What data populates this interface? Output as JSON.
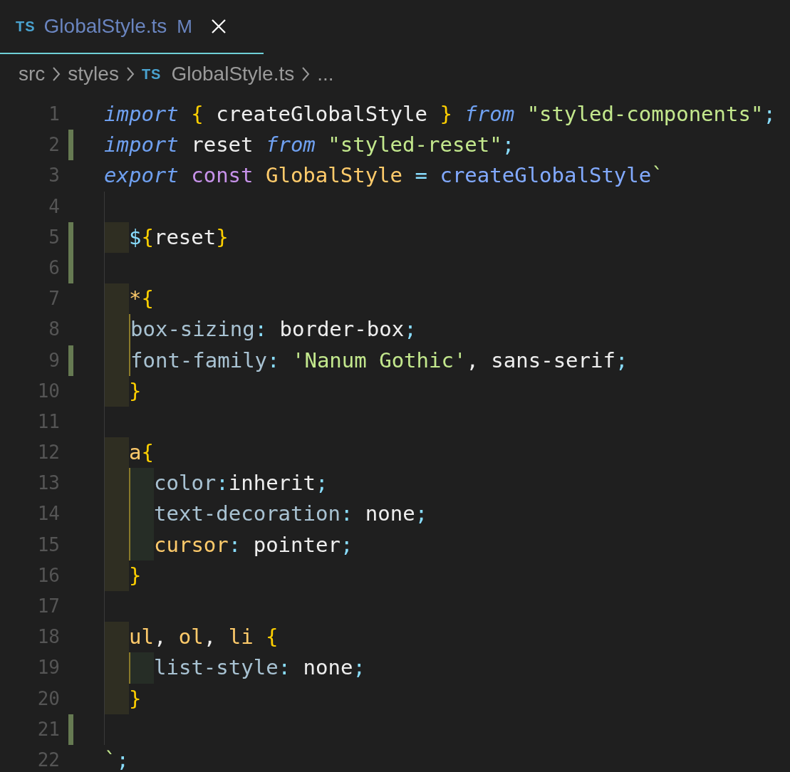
{
  "tab": {
    "icon_label": "TS",
    "title": "GlobalStyle.ts",
    "status": "M",
    "selected": true
  },
  "breadcrumbs": [
    {
      "label": "src"
    },
    {
      "label": "styles"
    },
    {
      "icon_label": "TS",
      "label": "GlobalStyle.ts"
    },
    {
      "label": "..."
    }
  ],
  "lines": [
    {
      "number": "1",
      "modified": false,
      "tokens": [
        {
          "kind": "keyword",
          "text": "import "
        },
        {
          "kind": "bracket",
          "text": "{"
        },
        {
          "kind": "plain",
          "text": " createGlobalStyle "
        },
        {
          "kind": "bracket",
          "text": "} "
        },
        {
          "kind": "keyword",
          "text": "from "
        },
        {
          "kind": "string",
          "text": "\"styled-components\""
        },
        {
          "kind": "punctuation",
          "text": ";"
        }
      ]
    },
    {
      "number": "2",
      "modified": true,
      "tokens": [
        {
          "kind": "keyword",
          "text": "import "
        },
        {
          "kind": "plain",
          "text": "reset "
        },
        {
          "kind": "keyword",
          "text": "from "
        },
        {
          "kind": "string",
          "text": "\"styled-reset\""
        },
        {
          "kind": "punctuation",
          "text": ";"
        }
      ]
    },
    {
      "number": "3",
      "modified": false,
      "tokens": [
        {
          "kind": "keyword",
          "text": "export "
        },
        {
          "kind": "storage",
          "text": "const "
        },
        {
          "kind": "class",
          "text": "GlobalStyle "
        },
        {
          "kind": "punctuation",
          "text": "= "
        },
        {
          "kind": "function",
          "text": "createGlobalStyle"
        },
        {
          "kind": "string",
          "text": "`"
        }
      ]
    },
    {
      "number": "4",
      "modified": false,
      "guides": [
        {
          "kind": "line"
        }
      ]
    },
    {
      "number": "5",
      "modified": true,
      "guides": [
        {
          "kind": "block"
        }
      ],
      "tokens": [
        {
          "kind": "punctuation",
          "text": "$"
        },
        {
          "kind": "bracket",
          "text": "{"
        },
        {
          "kind": "plain",
          "text": "reset"
        },
        {
          "kind": "bracket",
          "text": "}"
        }
      ]
    },
    {
      "number": "6",
      "modified": true,
      "guides": [
        {
          "kind": "line"
        }
      ]
    },
    {
      "number": "7",
      "modified": false,
      "guides": [
        {
          "kind": "block"
        }
      ],
      "tokens": [
        {
          "kind": "selector",
          "text": "*"
        },
        {
          "kind": "bracket",
          "text": "{"
        }
      ]
    },
    {
      "number": "8",
      "modified": false,
      "guides": [
        {
          "kind": "block"
        },
        {
          "kind": "bar"
        }
      ],
      "tokens": [
        {
          "kind": "property",
          "text": "box-sizing"
        },
        {
          "kind": "punctuation",
          "text": ": "
        },
        {
          "kind": "plain",
          "text": "border-box"
        },
        {
          "kind": "punctuation",
          "text": ";"
        }
      ]
    },
    {
      "number": "9",
      "modified": true,
      "guides": [
        {
          "kind": "block"
        },
        {
          "kind": "bar"
        }
      ],
      "tokens": [
        {
          "kind": "property",
          "text": "font-family"
        },
        {
          "kind": "punctuation",
          "text": ": "
        },
        {
          "kind": "string",
          "text": "'Nanum Gothic'"
        },
        {
          "kind": "plain",
          "text": ", sans-serif"
        },
        {
          "kind": "punctuation",
          "text": ";"
        }
      ]
    },
    {
      "number": "10",
      "modified": false,
      "guides": [
        {
          "kind": "block"
        }
      ],
      "tokens": [
        {
          "kind": "bracket",
          "text": "}"
        }
      ]
    },
    {
      "number": "11",
      "modified": false,
      "guides": [
        {
          "kind": "line"
        }
      ]
    },
    {
      "number": "12",
      "modified": false,
      "guides": [
        {
          "kind": "block"
        }
      ],
      "tokens": [
        {
          "kind": "selector",
          "text": "a"
        },
        {
          "kind": "bracket",
          "text": "{"
        }
      ]
    },
    {
      "number": "13",
      "modified": false,
      "guides": [
        {
          "kind": "block"
        },
        {
          "kind": "inner"
        }
      ],
      "tokens": [
        {
          "kind": "property",
          "text": "color"
        },
        {
          "kind": "punctuation",
          "text": ":"
        },
        {
          "kind": "plain",
          "text": "inherit"
        },
        {
          "kind": "punctuation",
          "text": ";"
        }
      ]
    },
    {
      "number": "14",
      "modified": false,
      "guides": [
        {
          "kind": "block"
        },
        {
          "kind": "inner"
        }
      ],
      "tokens": [
        {
          "kind": "property",
          "text": "text-decoration"
        },
        {
          "kind": "punctuation",
          "text": ": "
        },
        {
          "kind": "plain",
          "text": "none"
        },
        {
          "kind": "punctuation",
          "text": ";"
        }
      ]
    },
    {
      "number": "15",
      "modified": false,
      "guides": [
        {
          "kind": "block"
        },
        {
          "kind": "inner"
        }
      ],
      "tokens": [
        {
          "kind": "selector",
          "text": "cursor"
        },
        {
          "kind": "punctuation",
          "text": ": "
        },
        {
          "kind": "plain",
          "text": "pointer"
        },
        {
          "kind": "punctuation",
          "text": ";"
        }
      ]
    },
    {
      "number": "16",
      "modified": false,
      "guides": [
        {
          "kind": "block"
        }
      ],
      "tokens": [
        {
          "kind": "bracket",
          "text": "}"
        }
      ]
    },
    {
      "number": "17",
      "modified": false,
      "guides": [
        {
          "kind": "line"
        }
      ]
    },
    {
      "number": "18",
      "modified": false,
      "guides": [
        {
          "kind": "block"
        }
      ],
      "tokens": [
        {
          "kind": "selector",
          "text": "ul"
        },
        {
          "kind": "plain",
          "text": ", "
        },
        {
          "kind": "selector",
          "text": "ol"
        },
        {
          "kind": "plain",
          "text": ", "
        },
        {
          "kind": "selector",
          "text": "li "
        },
        {
          "kind": "bracket",
          "text": "{"
        }
      ]
    },
    {
      "number": "19",
      "modified": false,
      "guides": [
        {
          "kind": "block"
        },
        {
          "kind": "inner"
        }
      ],
      "tokens": [
        {
          "kind": "property",
          "text": "list-style"
        },
        {
          "kind": "punctuation",
          "text": ": "
        },
        {
          "kind": "plain",
          "text": "none"
        },
        {
          "kind": "punctuation",
          "text": ";"
        }
      ]
    },
    {
      "number": "20",
      "modified": false,
      "guides": [
        {
          "kind": "block"
        }
      ],
      "tokens": [
        {
          "kind": "bracket",
          "text": "}"
        }
      ]
    },
    {
      "number": "21",
      "modified": true,
      "guides": [
        {
          "kind": "line"
        }
      ]
    },
    {
      "number": "22",
      "modified": false,
      "tokens": [
        {
          "kind": "string",
          "text": "`"
        },
        {
          "kind": "punctuation",
          "text": ";"
        }
      ]
    }
  ]
}
